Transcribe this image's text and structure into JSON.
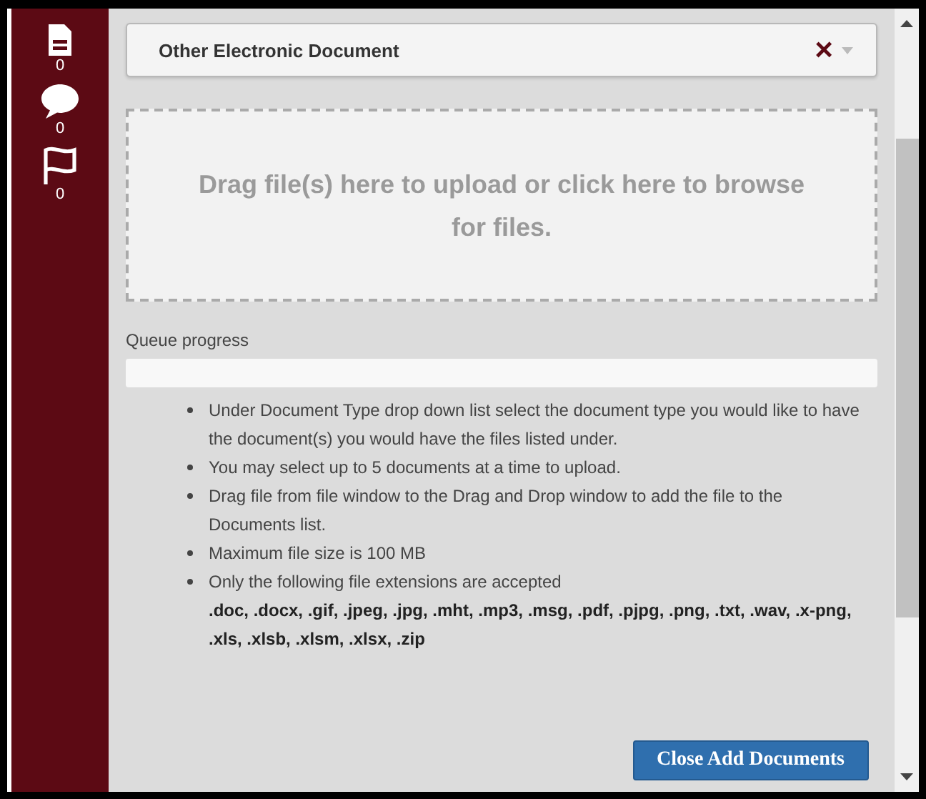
{
  "sidebar": {
    "items": [
      {
        "kind": "document",
        "count": "0"
      },
      {
        "kind": "comment",
        "count": "0"
      },
      {
        "kind": "flag",
        "count": "0"
      }
    ]
  },
  "document_type": {
    "value": "Other Electronic Document",
    "clear": "×"
  },
  "dropzone": {
    "text": "Drag file(s) here to upload or click here to browse for files."
  },
  "queue": {
    "label": "Queue progress"
  },
  "instructions": [
    {
      "text": "Under Document Type drop down list select the document type you would like to have the document(s) you would have the files listed under."
    },
    {
      "text": "You may select up to 5 documents at a time to upload."
    },
    {
      "text": "Drag file from file window to the Drag and Drop window to add the file to the Documents list."
    },
    {
      "text": "Maximum file size is 100 MB"
    },
    {
      "text": "Only the following file extensions are accepted",
      "extensions": ".doc, .docx, .gif, .jpeg, .jpg, .mht, .mp3, .msg, .pdf, .pjpg, .png, .txt, .wav, .x-png, .xls, .xlsb, .xlsm, .xlsx, .zip"
    }
  ],
  "close_button": "Close Add Documents"
}
